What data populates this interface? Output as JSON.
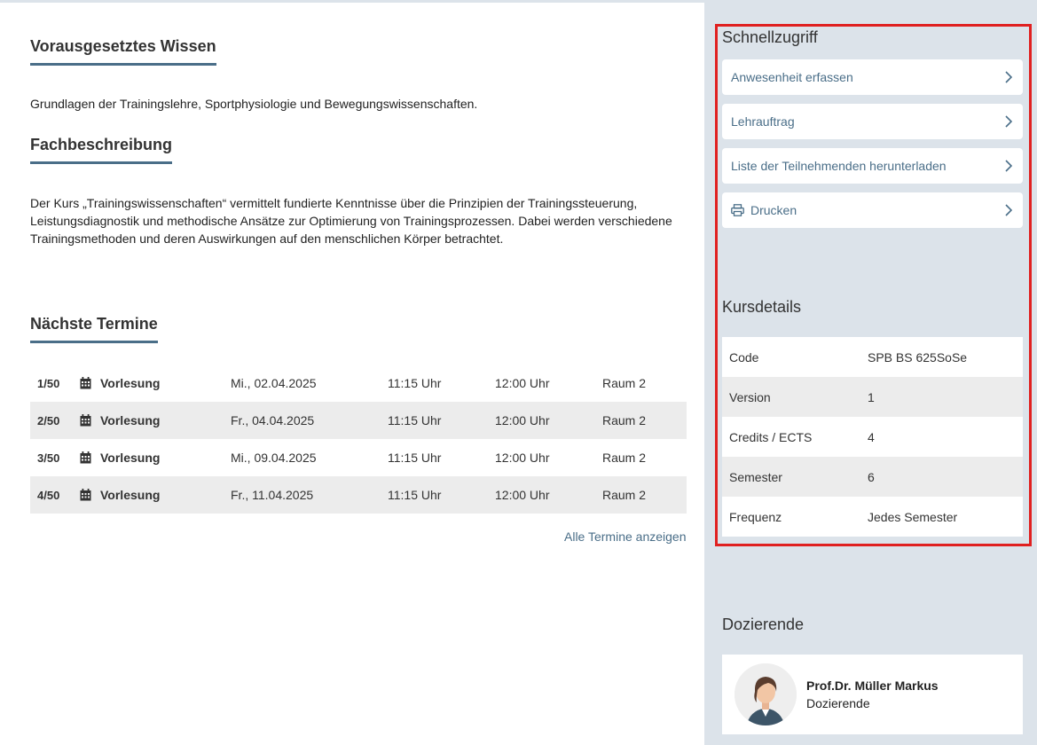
{
  "main": {
    "prereq_title": "Vorausgesetztes Wissen",
    "prereq_text": "Grundlagen der Trainingslehre, Sportphysiologie und Bewegungswissenschaften.",
    "desc_title": "Fachbeschreibung",
    "desc_text": "Der Kurs „Trainingswissenschaften“ vermittelt fundierte Kenntnisse über die Prinzipien der Trainingssteuerung, Leistungsdiagnostik und methodische Ansätze zur Optimierung von Trainingsprozessen. Dabei werden verschiedene Trainingsmethoden und deren Auswirkungen auf den menschlichen Körper betrachtet.",
    "next_title": "Nächste Termine",
    "appointments": [
      {
        "num": "1/50",
        "type": "Vorlesung",
        "date": "Mi., 02.04.2025",
        "start": "11:15 Uhr",
        "end": "12:00 Uhr",
        "room": "Raum 2"
      },
      {
        "num": "2/50",
        "type": "Vorlesung",
        "date": "Fr., 04.04.2025",
        "start": "11:15 Uhr",
        "end": "12:00 Uhr",
        "room": "Raum 2"
      },
      {
        "num": "3/50",
        "type": "Vorlesung",
        "date": "Mi., 09.04.2025",
        "start": "11:15 Uhr",
        "end": "12:00 Uhr",
        "room": "Raum 2"
      },
      {
        "num": "4/50",
        "type": "Vorlesung",
        "date": "Fr., 11.04.2025",
        "start": "11:15 Uhr",
        "end": "12:00 Uhr",
        "room": "Raum 2"
      }
    ],
    "all_link": "Alle Termine anzeigen"
  },
  "sidebar": {
    "quick_title": "Schnellzugriff",
    "quick_items": [
      {
        "label": "Anwesenheit erfassen"
      },
      {
        "label": "Lehrauftrag"
      },
      {
        "label": "Liste der Teilnehmenden herunterladen"
      },
      {
        "label": "Drucken",
        "icon": "printer-icon"
      }
    ],
    "details_title": "Kursdetails",
    "details": [
      {
        "key": "Code",
        "value": "SPB BS 625SoSe"
      },
      {
        "key": "Version",
        "value": "1"
      },
      {
        "key": "Credits / ECTS",
        "value": "4"
      },
      {
        "key": "Semester",
        "value": "6"
      },
      {
        "key": "Frequenz",
        "value": "Jedes Semester"
      }
    ],
    "teachers_title": "Dozierende",
    "teacher": {
      "name": "Prof.Dr. Müller Markus",
      "role": "Dozierende"
    }
  },
  "colors": {
    "accent": "#4a6e88",
    "sidebar_bg": "#dce3ea",
    "highlight": "#e02020",
    "row_alt": "#ececec"
  }
}
